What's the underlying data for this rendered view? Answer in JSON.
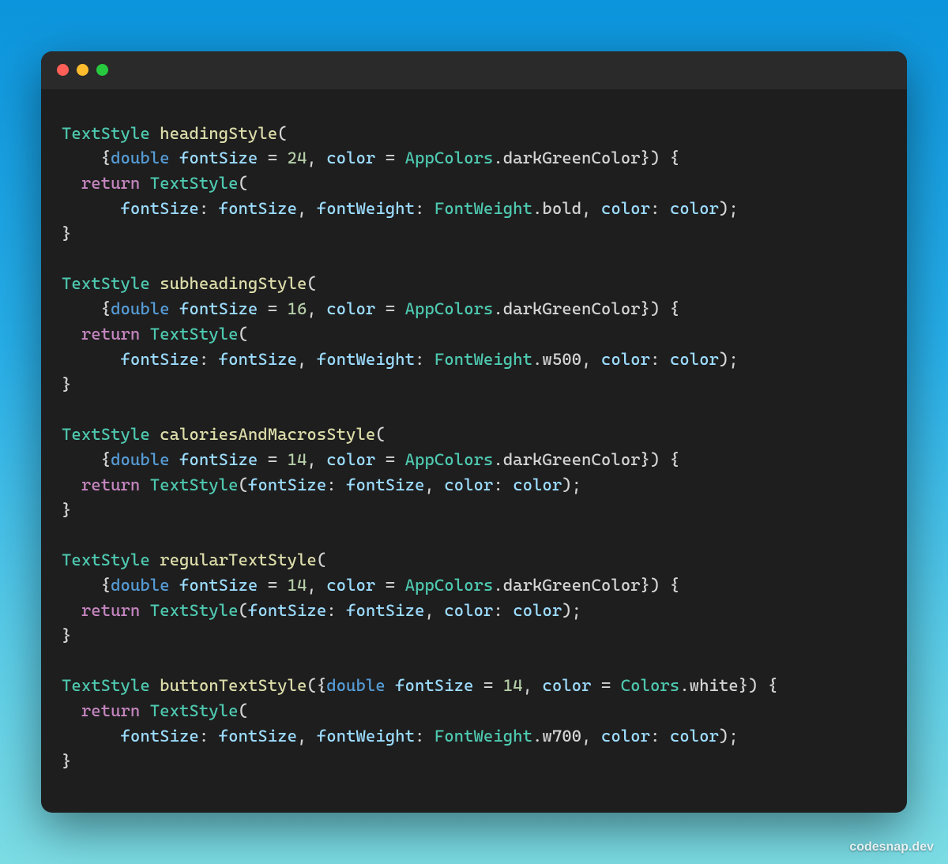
{
  "watermark": "codesnap.dev",
  "window": {
    "traffic_lights": [
      "close",
      "minimize",
      "maximize"
    ]
  },
  "code": {
    "language": "dart",
    "functions": [
      {
        "return_type": "TextStyle",
        "name": "headingStyle",
        "params": [
          {
            "type": "double",
            "name": "fontSize",
            "default": "24"
          },
          {
            "type": null,
            "name": "color",
            "default": "AppColors.darkGreenColor"
          }
        ],
        "body_return": "TextStyle",
        "body_args": [
          {
            "label": "fontSize",
            "value_ref": "fontSize"
          },
          {
            "label": "fontWeight",
            "value_ref": "FontWeight.bold"
          },
          {
            "label": "color",
            "value_ref": "color"
          }
        ],
        "multiline_body": true
      },
      {
        "return_type": "TextStyle",
        "name": "subheadingStyle",
        "params": [
          {
            "type": "double",
            "name": "fontSize",
            "default": "16"
          },
          {
            "type": null,
            "name": "color",
            "default": "AppColors.darkGreenColor"
          }
        ],
        "body_return": "TextStyle",
        "body_args": [
          {
            "label": "fontSize",
            "value_ref": "fontSize"
          },
          {
            "label": "fontWeight",
            "value_ref": "FontWeight.w500"
          },
          {
            "label": "color",
            "value_ref": "color"
          }
        ],
        "multiline_body": true
      },
      {
        "return_type": "TextStyle",
        "name": "caloriesAndMacrosStyle",
        "params": [
          {
            "type": "double",
            "name": "fontSize",
            "default": "14"
          },
          {
            "type": null,
            "name": "color",
            "default": "AppColors.darkGreenColor"
          }
        ],
        "body_return": "TextStyle",
        "body_args": [
          {
            "label": "fontSize",
            "value_ref": "fontSize"
          },
          {
            "label": "color",
            "value_ref": "color"
          }
        ],
        "multiline_body": false
      },
      {
        "return_type": "TextStyle",
        "name": "regularTextStyle",
        "params": [
          {
            "type": "double",
            "name": "fontSize",
            "default": "14"
          },
          {
            "type": null,
            "name": "color",
            "default": "AppColors.darkGreenColor"
          }
        ],
        "body_return": "TextStyle",
        "body_args": [
          {
            "label": "fontSize",
            "value_ref": "fontSize"
          },
          {
            "label": "color",
            "value_ref": "color"
          }
        ],
        "multiline_body": false
      },
      {
        "return_type": "TextStyle",
        "name": "buttonTextStyle",
        "params_inline": true,
        "params": [
          {
            "type": "double",
            "name": "fontSize",
            "default": "14"
          },
          {
            "type": null,
            "name": "color",
            "default": "Colors.white"
          }
        ],
        "body_return": "TextStyle",
        "body_args": [
          {
            "label": "fontSize",
            "value_ref": "fontSize"
          },
          {
            "label": "fontWeight",
            "value_ref": "FontWeight.w700"
          },
          {
            "label": "color",
            "value_ref": "color"
          }
        ],
        "multiline_body": true
      }
    ]
  }
}
